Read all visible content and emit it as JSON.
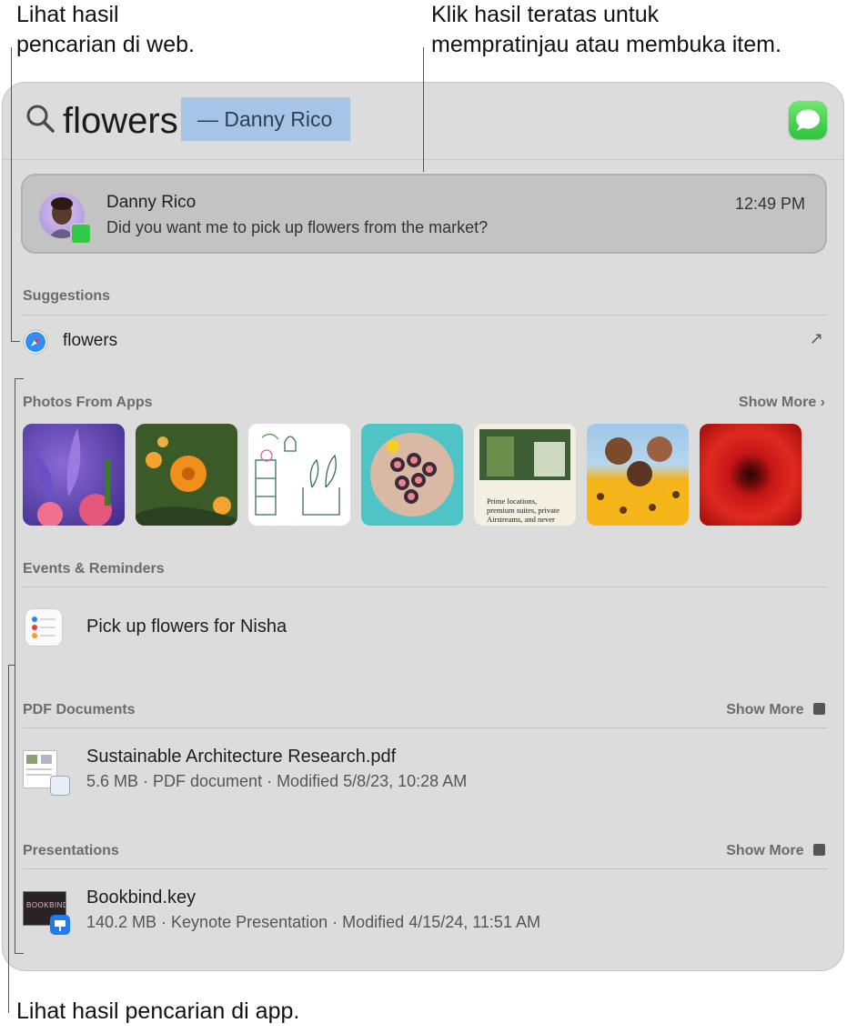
{
  "callouts": {
    "web": [
      "Lihat hasil",
      "pencarian di web."
    ],
    "top_hit": [
      "Klik hasil teratas untuk",
      "mempratinjau atau membuka item."
    ],
    "apps": "Lihat hasil pencarian di app."
  },
  "search": {
    "query": "flowers",
    "suggestion": "— Danny Rico"
  },
  "top_hit": {
    "name": "Danny Rico",
    "message": "Did you want me to pick up flowers from the market?",
    "time": "12:49 PM"
  },
  "suggestions": {
    "title": "Suggestions",
    "items": [
      {
        "label": "flowers",
        "icon": "safari-icon",
        "action_glyph": "↗"
      }
    ]
  },
  "photos": {
    "title": "Photos From Apps",
    "show_more": "Show More ›",
    "items": [
      {
        "name": "iris-flowers",
        "colors": [
          "#4b3b9a",
          "#e05a7a"
        ]
      },
      {
        "name": "orange-flowers",
        "colors": [
          "#3c5a2a",
          "#f08a1c"
        ]
      },
      {
        "name": "plant-sketch",
        "colors": [
          "#ffffff",
          "#6aa0b0"
        ]
      },
      {
        "name": "sushi-plate",
        "colors": [
          "#49c3c6",
          "#8b5a6a"
        ]
      },
      {
        "name": "magazine-page",
        "caption": "Prime locations, premium suites, private Airstreams, and never",
        "colors": [
          "#f3efe3",
          "#2e4a2a"
        ]
      },
      {
        "name": "friends-sunflowers",
        "colors": [
          "#f5b41a",
          "#6b4a2a"
        ]
      },
      {
        "name": "red-gerbera",
        "colors": [
          "#d41f1f",
          "#5a0a0a"
        ]
      }
    ]
  },
  "events": {
    "title": "Events & Reminders",
    "items": [
      {
        "label": "Pick up flowers for Nisha"
      }
    ]
  },
  "pdf": {
    "title": "PDF Documents",
    "show_more": "Show More",
    "items": [
      {
        "name": "Sustainable Architecture Research.pdf",
        "meta": "5.6 MB · PDF document · Modified 5/8/23, 10:28 AM"
      }
    ]
  },
  "presentations": {
    "title": "Presentations",
    "show_more": "Show More",
    "items": [
      {
        "name": "Bookbind.key",
        "meta": "140.2 MB · Keynote Presentation · Modified 4/15/24, 11:51 AM",
        "thumb_text": "BOOKBIND"
      }
    ]
  }
}
